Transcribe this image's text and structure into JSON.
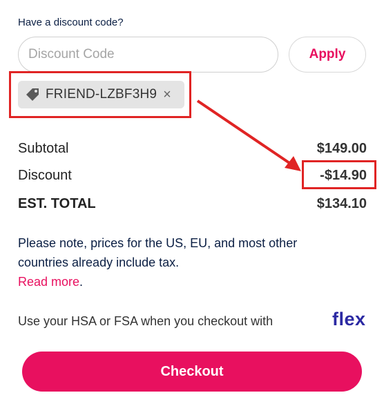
{
  "discount": {
    "prompt": "Have a discount code?",
    "input_placeholder": "Discount Code",
    "input_value": "",
    "apply_label": "Apply",
    "applied_code": "FRIEND-LZBF3H9",
    "remove_glyph": "×",
    "tag_icon": "tag-icon"
  },
  "summary": {
    "subtotal_label": "Subtotal",
    "subtotal_value": "$149.00",
    "discount_label": "Discount",
    "discount_value": "-$14.90",
    "total_label": "EST. TOTAL",
    "total_value": "$134.10"
  },
  "tax_note": {
    "text": "Please note, prices for the US, EU, and most other countries already include tax.",
    "link_label": "Read more",
    "trailing": "."
  },
  "payment": {
    "hsa_text": "Use your HSA or FSA when you checkout with",
    "flex_logo": "flex"
  },
  "checkout": {
    "label": "Checkout"
  },
  "colors": {
    "accent": "#e8105f",
    "annotation_red": "#e02424",
    "flex_blue": "#2c2aa3",
    "navy_text": "#0b1f44",
    "chip_bg": "#e4e4e4"
  }
}
